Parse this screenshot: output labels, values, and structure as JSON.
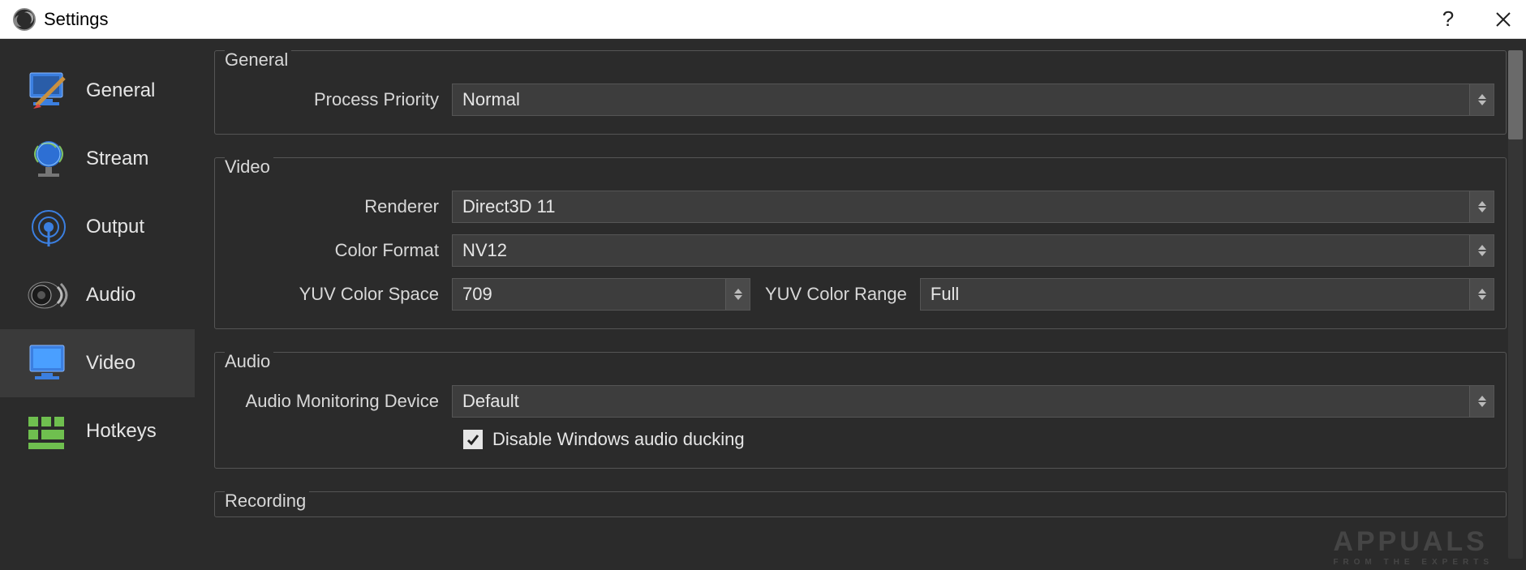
{
  "window": {
    "title": "Settings"
  },
  "sidebar": {
    "items": [
      {
        "label": "General"
      },
      {
        "label": "Stream"
      },
      {
        "label": "Output"
      },
      {
        "label": "Audio"
      },
      {
        "label": "Video"
      },
      {
        "label": "Hotkeys"
      }
    ]
  },
  "groups": {
    "general": {
      "title": "General",
      "process_priority_label": "Process Priority",
      "process_priority_value": "Normal"
    },
    "video": {
      "title": "Video",
      "renderer_label": "Renderer",
      "renderer_value": "Direct3D 11",
      "color_format_label": "Color Format",
      "color_format_value": "NV12",
      "yuv_color_space_label": "YUV Color Space",
      "yuv_color_space_value": "709",
      "yuv_color_range_label": "YUV Color Range",
      "yuv_color_range_value": "Full"
    },
    "audio": {
      "title": "Audio",
      "monitoring_device_label": "Audio Monitoring Device",
      "monitoring_device_value": "Default",
      "disable_ducking_label": "Disable Windows audio ducking",
      "disable_ducking_checked": true
    },
    "recording": {
      "title": "Recording"
    }
  },
  "watermark": {
    "main": "APPUALS",
    "sub": "FROM THE EXPERTS"
  }
}
